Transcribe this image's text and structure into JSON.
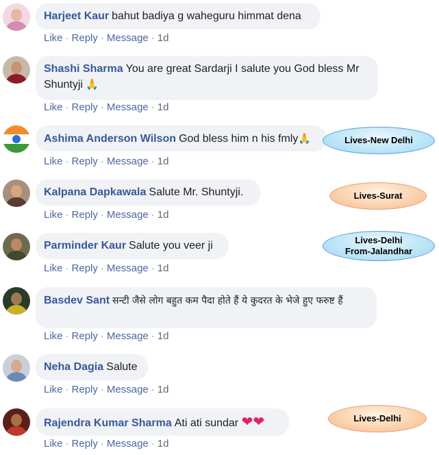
{
  "actions": {
    "like": "Like",
    "reply": "Reply",
    "message": "Message",
    "sep": "·"
  },
  "comments": [
    {
      "author": "Harjeet Kaur",
      "text": "bahut badiya g waheguru himmat dena",
      "time": "1d"
    },
    {
      "author": "Shashi Sharma",
      "text": "You are great Sardarji I salute you God bless Mr Shuntyji",
      "emoji": "🙏",
      "time": "1d"
    },
    {
      "author": "Ashima Anderson Wilson",
      "text": "God bless him n his fmly",
      "emoji": "🙏",
      "time": "1d"
    },
    {
      "author": "Kalpana Dapkawala",
      "text": "Salute Mr. Shuntyji.",
      "time": "1d"
    },
    {
      "author": "Parminder Kaur",
      "text": "Salute you veer ji",
      "time": "1d"
    },
    {
      "author": "Basdev Sant",
      "text": "सन्टी जैसे लोग बहुत कम पैदा होते हैं ये कुदरत के भेजे हुए फरुष्ट हैं",
      "time": "1d"
    },
    {
      "author": "Neha Dagia",
      "text": "Salute",
      "time": "1d"
    },
    {
      "author": "Rajendra Kumar Sharma",
      "text": "Ati ati sundar",
      "emoji": "❤❤",
      "time": "1d"
    }
  ],
  "tags": [
    {
      "line1": "Lives-New Delhi",
      "line2": ""
    },
    {
      "line1": "Lives-Surat",
      "line2": ""
    },
    {
      "line1": "Lives-Delhi",
      "line2": "From-Jalandhar"
    },
    {
      "line1": "Lives-Delhi",
      "line2": ""
    }
  ],
  "colors": {
    "author": "#385898",
    "bubble": "#f0f2f5",
    "action_link": "#4b67a1",
    "tag_blue": "#bfe6f8",
    "tag_orange": "#fbd3b0"
  }
}
